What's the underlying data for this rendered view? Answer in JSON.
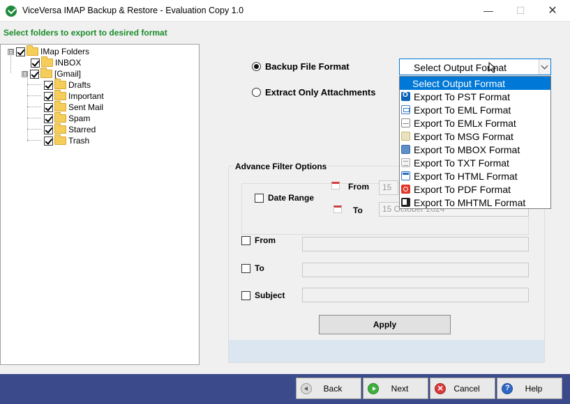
{
  "window": {
    "title": "ViceVersa IMAP Backup & Restore - Evaluation Copy 1.0",
    "minimize": "—",
    "maximize": "☐",
    "close": "✕"
  },
  "instruction": "Select folders to export to desired format",
  "tree": {
    "root": "IMap Folders",
    "inbox": "INBOX",
    "gmail": "[Gmail]",
    "children": [
      "Drafts",
      "Important",
      "Sent Mail",
      "Spam",
      "Starred",
      "Trash"
    ],
    "expander_symbol": "⊟"
  },
  "options": {
    "backup_label": "Backup File Format",
    "attachments_label": "Extract Only Attachments"
  },
  "format_select": {
    "selected": "Select Output Format",
    "options": [
      {
        "label": "Select Output Format",
        "icon": "none"
      },
      {
        "label": "Export To PST Format",
        "icon": "outlook-icon"
      },
      {
        "label": "Export To EML Format",
        "icon": "eml-icon"
      },
      {
        "label": "Export To EMLx Format",
        "icon": "emlx-icon"
      },
      {
        "label": "Export To MSG Format",
        "icon": "msg-icon"
      },
      {
        "label": "Export To MBOX Format",
        "icon": "mbox-icon"
      },
      {
        "label": "Export To TXT Format",
        "icon": "txt-icon"
      },
      {
        "label": "Export To HTML Format",
        "icon": "html-icon"
      },
      {
        "label": "Export To PDF Format",
        "icon": "pdf-icon"
      },
      {
        "label": "Export To MHTML Format",
        "icon": "mhtml-icon"
      }
    ]
  },
  "advance_filter": {
    "title": "Advance Filter Options",
    "date_range_label": "Date Range",
    "from_date_label": "From",
    "from_date_value": "15",
    "to_date_label": "To",
    "to_date_value": "15   October   2024",
    "from_label": "From",
    "to_label": "To",
    "subject_label": "Subject",
    "apply_label": "Apply"
  },
  "footer": {
    "back_label": "Back",
    "next_label": "Next",
    "cancel_label": "Cancel",
    "help_label": "Help"
  },
  "colors": {
    "accent": "#0078d7",
    "instruction_green": "#1a8c2a",
    "footer_bg": "#3b4a8a"
  }
}
